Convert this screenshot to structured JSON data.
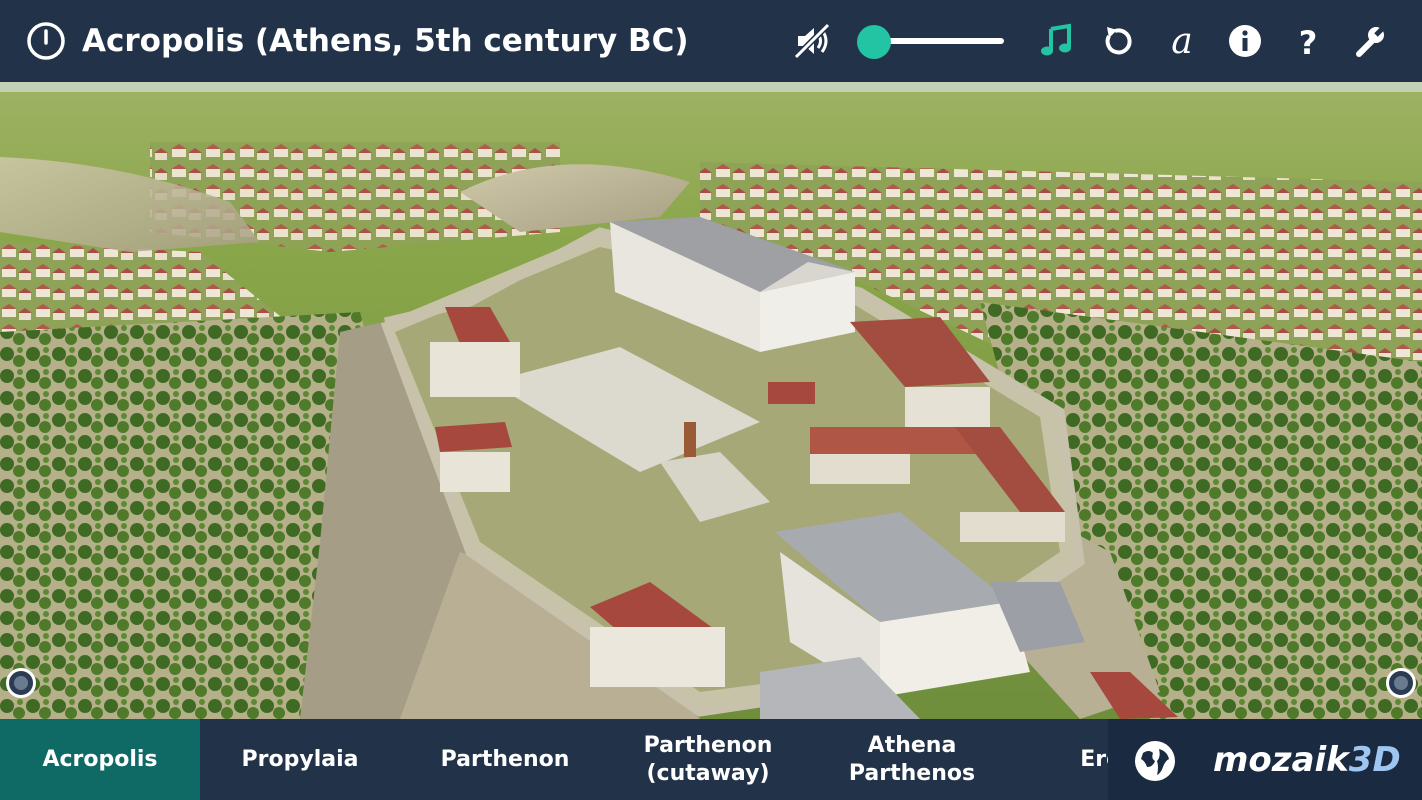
{
  "header": {
    "title": "Acropolis (Athens, 5th century BC)",
    "icons": [
      "power-icon",
      "sound-muted-icon",
      "volume-slider",
      "music-icon",
      "reset-icon",
      "font-icon",
      "info-icon",
      "help-icon",
      "settings-icon"
    ],
    "volume_level": 0.1
  },
  "colors": {
    "bar_bg": "#223349",
    "accent": "#22c4a4",
    "active_tab": "#0f6a66",
    "logo_accent": "#9fc6f0"
  },
  "tabs": [
    {
      "label": "Acropolis",
      "active": true
    },
    {
      "label": "Propylaia",
      "active": false
    },
    {
      "label": "Parthenon",
      "active": false
    },
    {
      "label": "Parthenon\n(cutaway)",
      "active": false
    },
    {
      "label": "Athena\nParthenos",
      "active": false
    },
    {
      "label": "Erech",
      "active": false
    }
  ],
  "brand": {
    "logo_main": "mozaik",
    "logo_accent": "3D"
  }
}
